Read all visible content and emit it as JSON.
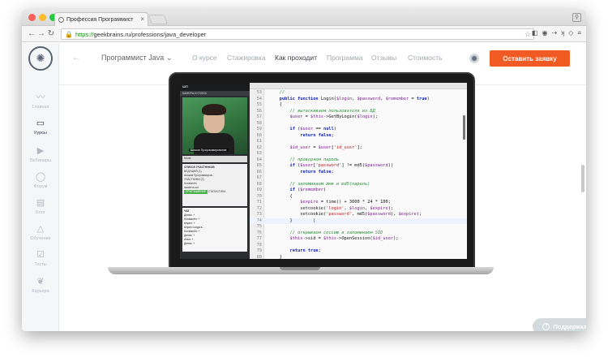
{
  "browser": {
    "tab_title": "Профессия Программист",
    "tab_close": "×",
    "url_https": "https://",
    "url_rest": "geekbrains.ru/professions/java_developer"
  },
  "sidebar": {
    "items": [
      {
        "icon": "pulse-icon",
        "glyph": "〰",
        "label": "Главная"
      },
      {
        "icon": "book-icon",
        "glyph": "▭",
        "label": "Курсы"
      },
      {
        "icon": "play-icon",
        "glyph": "▶",
        "label": "Вебинары"
      },
      {
        "icon": "chat-icon",
        "glyph": "◯",
        "label": "Форум"
      },
      {
        "icon": "blog-icon",
        "glyph": "▤",
        "label": "Блог"
      },
      {
        "icon": "education-icon",
        "glyph": "△",
        "label": "Обучение"
      },
      {
        "icon": "tests-icon",
        "glyph": "☑",
        "label": "Тесты"
      },
      {
        "icon": "career-icon",
        "glyph": "❦",
        "label": "Карьера"
      }
    ]
  },
  "nav": {
    "profession": "Программист Java",
    "menu": [
      "О курсе",
      "Стажировка",
      "Как проходит",
      "Программа",
      "Отзывы",
      "Стоимость"
    ],
    "active_index": 2,
    "cta": "Оставить заявку"
  },
  "webinar_app": {
    "logo": "ШП",
    "camera_title": "КАМЕРА И ГОЛОС",
    "camera_caption": "Шишов Программирование",
    "controls": "Mode",
    "participants_title": "СПИСОК УЧАСТНИКОВ",
    "participants": [
      "ВЕДУЩИЙ (1)",
      "Шишов Программиров...",
      "УЧАСТНИКИ (2)",
      "Konstantin",
      "swaterov.ad"
    ],
    "participants_btn": "ПРИГЛАШЕНИЕ",
    "participants_btn2": "СТАТИСТИКА",
    "chat_title": "ЧАТ",
    "chat_lines": [
      "Денис: +",
      "Konstantin: +",
      "shyam: +",
      "shyam: когда в...",
      "Konstantin: +",
      "Денис: +",
      "Илья: +",
      "Денис: +"
    ]
  },
  "code": {
    "lines": [
      {
        "n": "53",
        "t": "    //"
      },
      {
        "n": "54",
        "t": "    public function Login($login, $password, $remember = true)"
      },
      {
        "n": "55",
        "t": "    {"
      },
      {
        "n": "56",
        "t": "        // вытаскиваем пользователя из БД"
      },
      {
        "n": "57",
        "t": "        $user = $this->GetByLogin($login);"
      },
      {
        "n": "58",
        "t": ""
      },
      {
        "n": "59",
        "t": "        if ($user == null)"
      },
      {
        "n": "60",
        "t": "            return false;"
      },
      {
        "n": "61",
        "t": ""
      },
      {
        "n": "62",
        "t": "        $id_user = $user['id_user'];"
      },
      {
        "n": "63",
        "t": ""
      },
      {
        "n": "64",
        "t": "        // проверяем пароль"
      },
      {
        "n": "65",
        "t": "        if ($user['password'] != md5($password))"
      },
      {
        "n": "66",
        "t": "            return false;"
      },
      {
        "n": "67",
        "t": ""
      },
      {
        "n": "68",
        "t": "        // запоминаем имя и md5(пароль)"
      },
      {
        "n": "69",
        "t": "        if ($remember)"
      },
      {
        "n": "70",
        "t": "        {"
      },
      {
        "n": "71",
        "t": "            $expire = time() + 3600 * 24 * 100;"
      },
      {
        "n": "72",
        "t": "            setcookie('login', $login, $expire);"
      },
      {
        "n": "73",
        "t": "            setcookie('password', md5($password), $expire);"
      },
      {
        "n": "74",
        "t": "        }        |"
      },
      {
        "n": "75",
        "t": ""
      },
      {
        "n": "76",
        "t": "        // открываем сессию и запоминаем SID"
      },
      {
        "n": "77",
        "t": "        $this->sid = $this->OpenSession($id_user);"
      },
      {
        "n": "78",
        "t": ""
      },
      {
        "n": "79",
        "t": "        return true;"
      },
      {
        "n": "80",
        "t": "    }"
      },
      {
        "n": "81",
        "t": ""
      },
      {
        "n": "82",
        "t": "    //"
      }
    ],
    "current_line": "74"
  },
  "support": {
    "label": "Поддержка",
    "icon": "question-icon"
  },
  "colors": {
    "cta": "#f15a22",
    "active_underline": "#1e88e5",
    "sidebar_bg": "#f5f6f8"
  }
}
